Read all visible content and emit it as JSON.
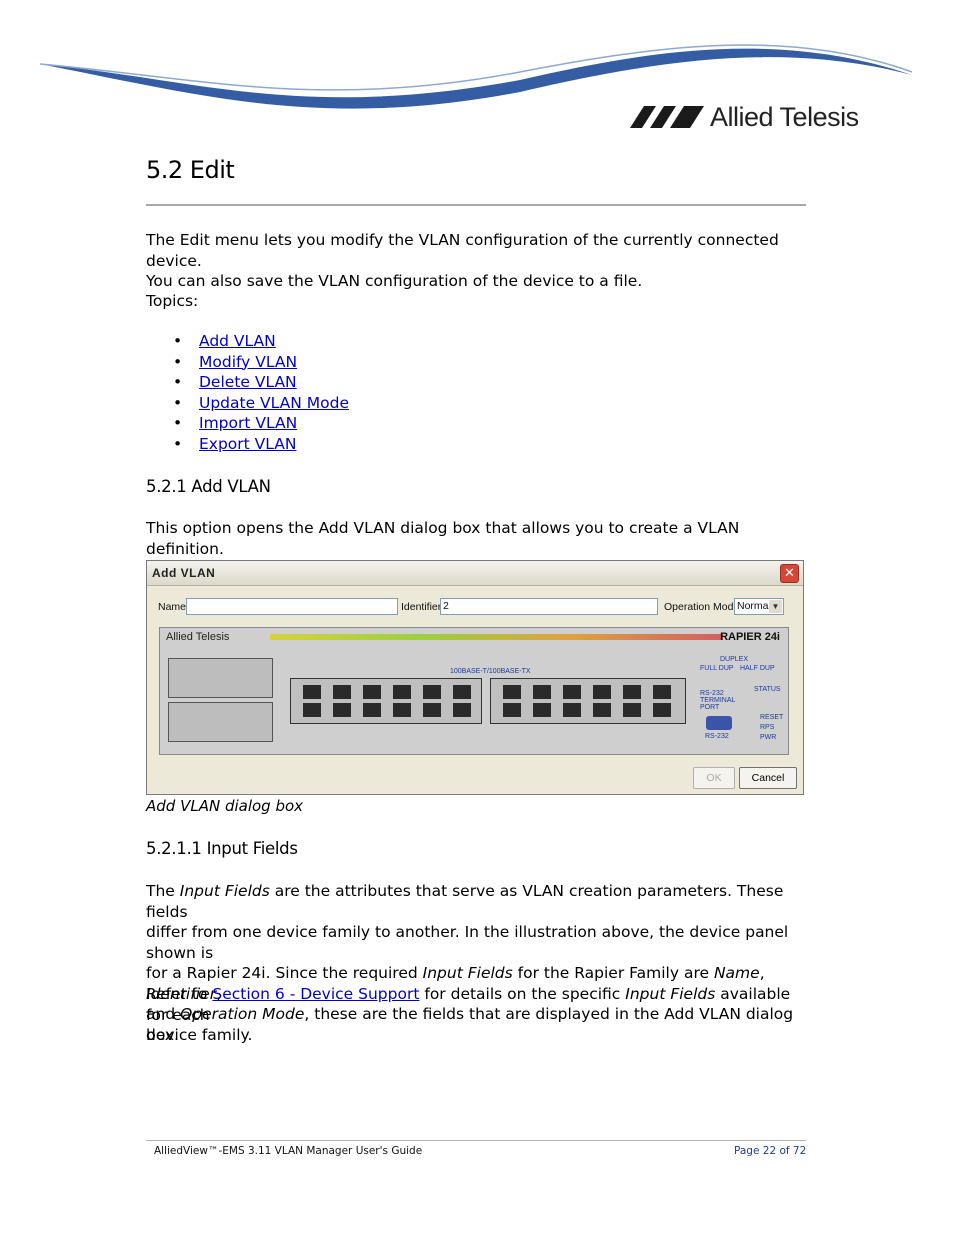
{
  "header": {
    "brand_name": "Allied Telesis"
  },
  "section": {
    "title": "5.2 Edit",
    "intro_line1": "The Edit menu lets you modify the VLAN configuration of the currently connected device.",
    "intro_line2": "You can also save the VLAN configuration of the device to a file.",
    "topics_label": "Topics:",
    "topics": [
      "Add VLAN",
      "Modify VLAN",
      "Delete VLAN",
      "Update VLAN Mode",
      "Import VLAN",
      "Export VLAN"
    ]
  },
  "add_vlan": {
    "heading": "5.2.1 Add VLAN",
    "description": "This option opens the Add VLAN dialog box that allows you to create a VLAN definition.",
    "caption": "Add VLAN dialog box"
  },
  "dialog": {
    "title": "Add VLAN",
    "close_glyph": "✕",
    "name_label": "Name",
    "name_value": "",
    "identifier_label": "Identifier",
    "identifier_value": "2",
    "operation_mode_label": "Operation Mode",
    "operation_mode_value": "Normal",
    "panel_brand": "Allied Telesis",
    "panel_model": "RAPIER 24i",
    "port_group_label": "100BASE-T/100BASE-TX",
    "duplex_label": "DUPLEX",
    "full_dup": "FULL DUP",
    "half_dup": "HALF DUP",
    "status_label": "STATUS",
    "rs232_label": "RS-232 TERMINAL PORT",
    "rs232_sub": "RS-232",
    "status_items": [
      "RESET",
      "RPS",
      "PWR"
    ],
    "ok_label": "OK",
    "cancel_label": "Cancel"
  },
  "input_fields": {
    "heading": "5.2.1.1 Input Fields",
    "p1_a": "The ",
    "p1_b": "Input Fields",
    "p1_c": " are the attributes that serve as VLAN creation parameters. These fields",
    "p1_line2": "differ from one device family to another. In the illustration above, the device panel shown is",
    "p1_line3_a": "for a Rapier 24i. Since the required ",
    "p1_line3_b": "Input Fields",
    "p1_line3_c": " for the Rapier Family are ",
    "p1_line3_d": "Name",
    "p1_line3_e": ", ",
    "p1_line3_f": "Identifier",
    "p1_line3_g": ",",
    "p1_line4_a": "and ",
    "p1_line4_b": "Operation Mode",
    "p1_line4_c": ", these are the fields that are displayed in the Add VLAN dialog box.",
    "p2_a": "Refer to ",
    "p2_link": "Section 6 - Device Support",
    "p2_b": " for details on the specific ",
    "p2_c": "Input Fields",
    "p2_d": " available for each",
    "p2_line2": "device family."
  },
  "footer": {
    "guide_title": "AlliedView™-EMS 3.11 VLAN Manager User's Guide",
    "page": "Page 22 of 72"
  },
  "colors": {
    "link": "#0000cc",
    "swoosh": "#1f4b9a"
  }
}
